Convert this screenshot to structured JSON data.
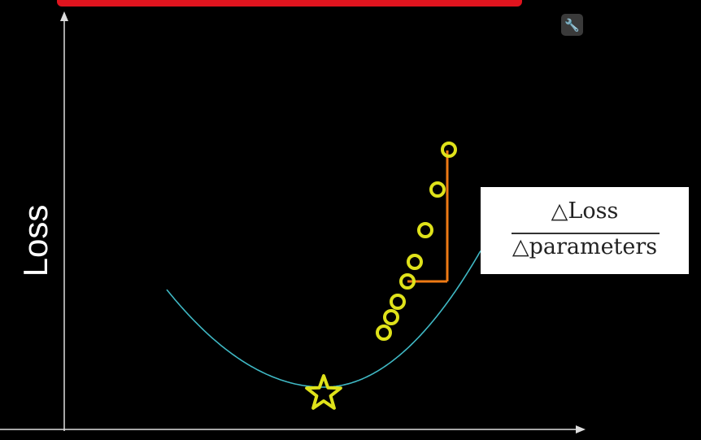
{
  "axes": {
    "y_label": "Loss"
  },
  "formula": {
    "numerator": "△Loss",
    "denominator": "△parameters"
  },
  "colors": {
    "curve": "#3fb8c4",
    "markers": "#dfe21a",
    "slope_lines": "#ee7a14",
    "axes": "#dddddd",
    "banner": "#e0141e"
  },
  "icons": {
    "tool": "wrench-icon"
  }
}
